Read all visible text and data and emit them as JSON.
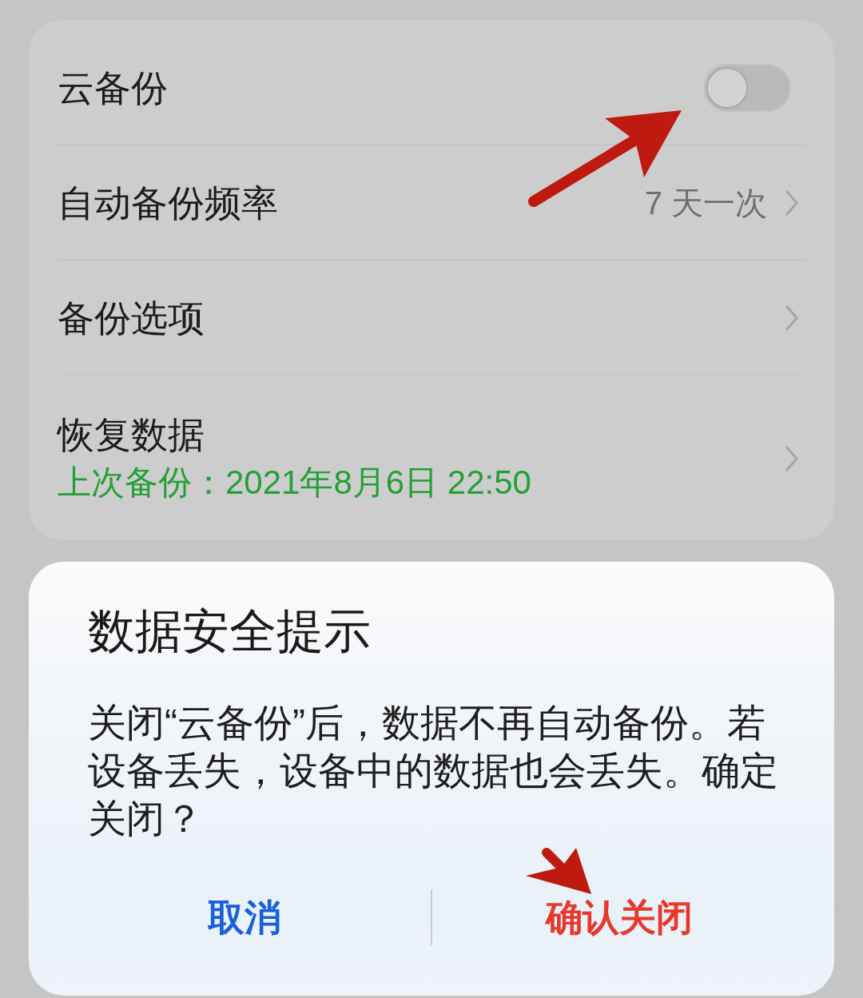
{
  "settings": {
    "items": [
      {
        "kind": "switch",
        "label": "云备份",
        "on": false
      },
      {
        "kind": "link",
        "label": "自动备份频率",
        "value": "7 天一次"
      },
      {
        "kind": "link",
        "label": "备份选项"
      },
      {
        "kind": "link",
        "label": "恢复数据",
        "subtitle": "上次备份：2021年8月6日 22:50"
      }
    ]
  },
  "dialog": {
    "title": "数据安全提示",
    "message": "关闭“云备份”后，数据不再自动备份。若设备丢失，设备中的数据也会丢失。确定关闭？",
    "buttons": [
      {
        "kind": "cancel",
        "label": "取消"
      },
      {
        "kind": "confirm",
        "label": "确认关闭"
      }
    ]
  }
}
